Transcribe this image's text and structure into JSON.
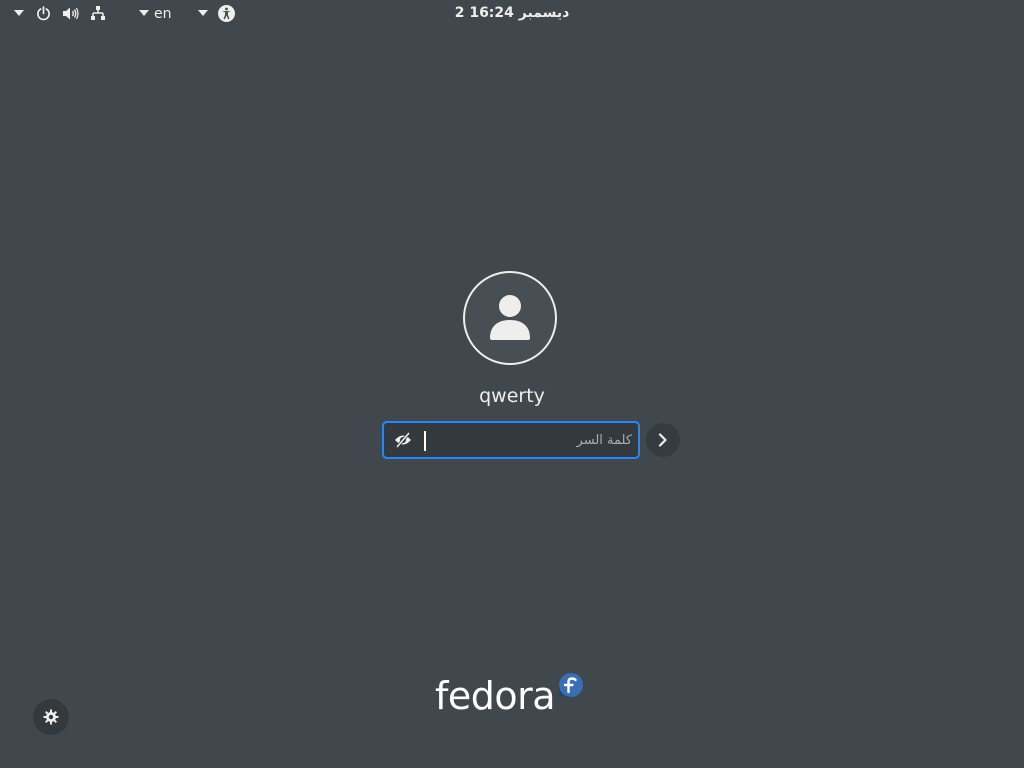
{
  "topbar": {
    "left_icons": [
      "dropdown-arrow-icon",
      "power-icon",
      "volume-icon",
      "network-wired-icon"
    ],
    "keyboard_layout": "en",
    "accessibility_icon": "accessibility-icon",
    "clock": "2 ديسمبر 16:24"
  },
  "login": {
    "username": "qwerty",
    "avatar_icon": "user-avatar-icon",
    "password": {
      "value": "",
      "placeholder": "كلمة السر",
      "reveal_icon": "eye-hidden-icon"
    },
    "next_icon": "chevron-right-icon"
  },
  "branding": {
    "logo_text": "fedora"
  },
  "settings_icon": "gear-icon",
  "colors": {
    "background": "#41484d",
    "accent": "#3584e4",
    "foreground": "#eeeeec",
    "fedora_blue": "#294172"
  }
}
